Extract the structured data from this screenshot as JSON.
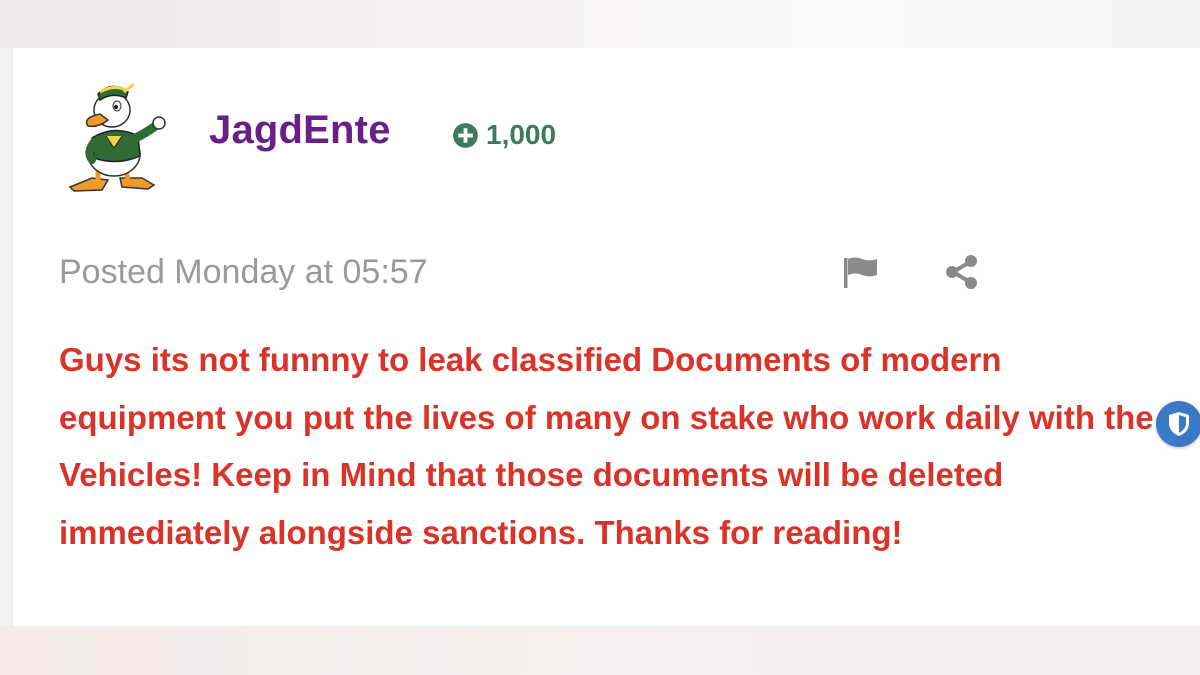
{
  "post": {
    "author": {
      "username": "JagdEnte",
      "reputation": "1,000",
      "reputation_icon": "plus-circle-icon",
      "avatar": "sailor-duck-avatar"
    },
    "meta": {
      "posted": "Posted Monday at 05:57"
    },
    "actions": {
      "report_icon": "flag-icon",
      "share_icon": "share-icon"
    },
    "body": "Guys its not funnny to leak classified Documents of modern equipment you put the lives of many on stake who work daily with the Vehicles! Keep in Mind that those documents will be deleted immediately alongside sanctions. Thanks for reading!"
  },
  "privacy_badge": {
    "icon": "shield-icon",
    "color": "#3a79c6"
  },
  "colors": {
    "username": "#6a1f86",
    "reputation": "#3e7a5f",
    "posted_text": "#9a9a9a",
    "body_text": "#d9332a",
    "icons": "#8a8a8a"
  }
}
